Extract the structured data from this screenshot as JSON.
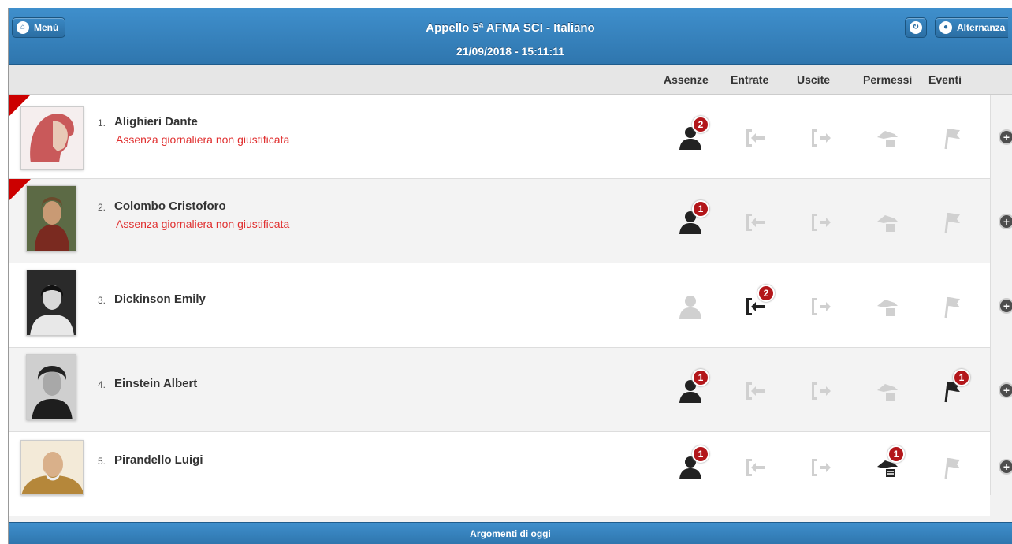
{
  "header": {
    "menu_label": "Menù",
    "title": "Appello 5ª AFMA SCI - Italiano",
    "datetime": "21/09/2018 - 15:11:11",
    "alternanza_label": "Alternanza"
  },
  "columns": {
    "assenze": "Assenze",
    "entrate": "Entrate",
    "uscite": "Uscite",
    "permessi": "Permessi",
    "eventi": "Eventi"
  },
  "students": [
    {
      "num": "1.",
      "name": "Alighieri Dante",
      "note": "Assenza giornaliera non giustificata",
      "flagged": true,
      "assenze": {
        "active": true,
        "count": "2"
      },
      "entrate": {
        "active": false
      },
      "uscite": {
        "active": false
      },
      "permessi": {
        "active": false
      },
      "eventi": {
        "active": false
      }
    },
    {
      "num": "2.",
      "name": "Colombo Cristoforo",
      "note": "Assenza giornaliera non giustificata",
      "flagged": true,
      "assenze": {
        "active": true,
        "count": "1"
      },
      "entrate": {
        "active": false
      },
      "uscite": {
        "active": false
      },
      "permessi": {
        "active": false
      },
      "eventi": {
        "active": false
      }
    },
    {
      "num": "3.",
      "name": "Dickinson Emily",
      "note": "",
      "flagged": false,
      "assenze": {
        "active": false
      },
      "entrate": {
        "active": true,
        "count": "2"
      },
      "uscite": {
        "active": false
      },
      "permessi": {
        "active": false
      },
      "eventi": {
        "active": false
      }
    },
    {
      "num": "4.",
      "name": "Einstein Albert",
      "note": "",
      "flagged": false,
      "assenze": {
        "active": true,
        "count": "1"
      },
      "entrate": {
        "active": false
      },
      "uscite": {
        "active": false
      },
      "permessi": {
        "active": false
      },
      "eventi": {
        "active": true,
        "count": "1"
      }
    },
    {
      "num": "5.",
      "name": "Pirandello Luigi",
      "note": "",
      "flagged": false,
      "assenze": {
        "active": true,
        "count": "1"
      },
      "entrate": {
        "active": false
      },
      "uscite": {
        "active": false
      },
      "permessi": {
        "active": true,
        "count": "1"
      },
      "eventi": {
        "active": false
      }
    }
  ],
  "footer": {
    "label": "Argomenti di oggi"
  },
  "colors": {
    "header_blue": "#3f8fcc",
    "badge_red": "#b3161a",
    "note_red": "#e03030",
    "icon_active": "#222222",
    "icon_inactive": "#d0d0d0"
  }
}
